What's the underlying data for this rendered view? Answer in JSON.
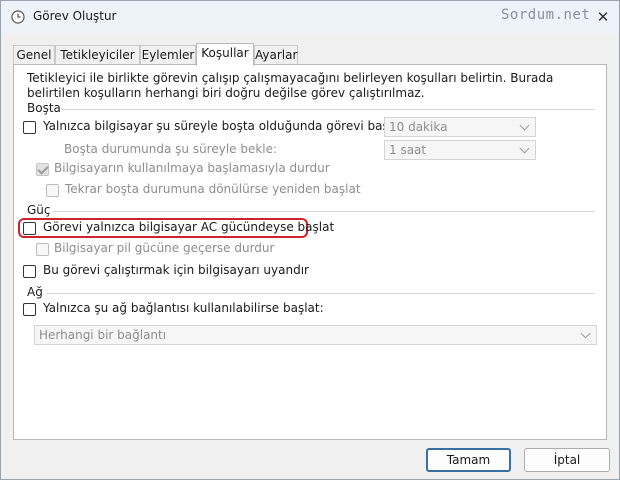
{
  "window": {
    "title": "Görev Oluştur",
    "watermark": "Sordum.net",
    "close_label": "✕"
  },
  "tabs": [
    {
      "label": "Genel"
    },
    {
      "label": "Tetikleyiciler"
    },
    {
      "label": "Eylemler"
    },
    {
      "label": "Koşullar"
    },
    {
      "label": "Ayarlar"
    }
  ],
  "active_tab": "Koşullar",
  "description": "Tetikleyici ile birlikte görevin çalışıp çalışmayacağını belirleyen koşulları belirtin. Burada belirtilen koşulların herhangi biri doğru değilse görev çalıştırılmaz.",
  "idle": {
    "section": "Boşta",
    "start_only_idle": {
      "label": "Yalnızca bilgisayar şu süreyle boşta olduğunda görevi başlat:",
      "checked": false
    },
    "idle_duration": {
      "value": "10 dakika"
    },
    "wait_label": "Boşta durumunda şu süreyle bekle:",
    "wait_duration": {
      "value": "1 saat"
    },
    "stop_if_active": {
      "label": "Bilgisayarın kullanılmaya başlamasıyla durdur",
      "checked": true
    },
    "restart_if_idle": {
      "label": "Tekrar boşta durumuna dönülürse yeniden başlat",
      "checked": false
    }
  },
  "power": {
    "section": "Güç",
    "start_only_ac": {
      "label": "Görevi yalnızca bilgisayar AC gücündeyse başlat",
      "checked": false
    },
    "stop_on_battery": {
      "label": "Bilgisayar pil gücüne geçerse durdur",
      "checked": false
    },
    "wake_to_run": {
      "label": "Bu görevi çalıştırmak için bilgisayarı uyandır",
      "checked": false
    }
  },
  "network": {
    "section": "Ağ",
    "start_only_network": {
      "label": "Yalnızca şu ağ bağlantısı kullanılabilirse başlat:",
      "checked": false
    },
    "connection": {
      "value": "Herhangi bir bağlantı"
    }
  },
  "buttons": {
    "ok": "Tamam",
    "cancel": "İptal"
  },
  "colors": {
    "highlight": "#d0232a",
    "primary_border": "#3a6ea5",
    "title_bar": "#eef3f9"
  }
}
